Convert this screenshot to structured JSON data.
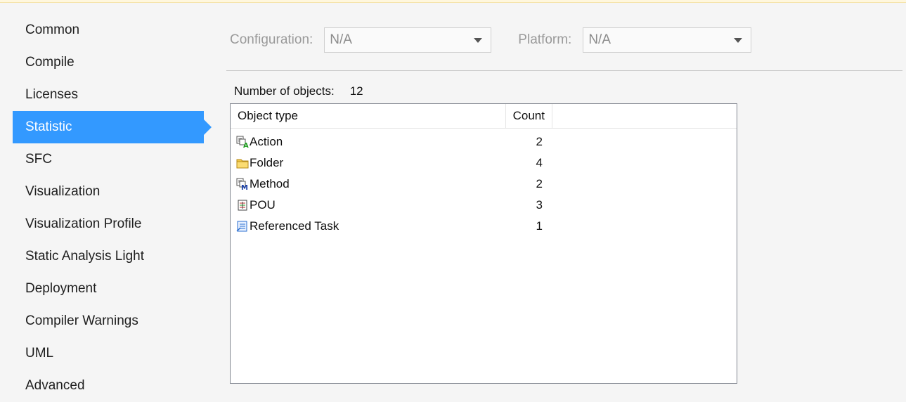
{
  "sidebar": {
    "items": [
      {
        "label": "Common"
      },
      {
        "label": "Compile"
      },
      {
        "label": "Licenses"
      },
      {
        "label": "Statistic",
        "active": true
      },
      {
        "label": "SFC"
      },
      {
        "label": "Visualization"
      },
      {
        "label": "Visualization Profile"
      },
      {
        "label": "Static Analysis Light"
      },
      {
        "label": "Deployment"
      },
      {
        "label": "Compiler Warnings"
      },
      {
        "label": "UML"
      },
      {
        "label": "Advanced"
      }
    ]
  },
  "config": {
    "configuration_label": "Configuration:",
    "configuration_value": "N/A",
    "platform_label": "Platform:",
    "platform_value": "N/A"
  },
  "stats": {
    "number_label": "Number of objects:",
    "number_value": "12"
  },
  "table": {
    "headers": {
      "type": "Object type",
      "count": "Count"
    },
    "rows": [
      {
        "icon": "action-icon",
        "type": "Action",
        "count": "2"
      },
      {
        "icon": "folder-icon",
        "type": "Folder",
        "count": "4"
      },
      {
        "icon": "method-icon",
        "type": "Method",
        "count": "2"
      },
      {
        "icon": "pou-icon",
        "type": "POU",
        "count": "3"
      },
      {
        "icon": "referenced-task-icon",
        "type": "Referenced Task",
        "count": "1"
      }
    ]
  },
  "colors": {
    "accent": "#3399ff",
    "selected_text": "#ffffff"
  }
}
